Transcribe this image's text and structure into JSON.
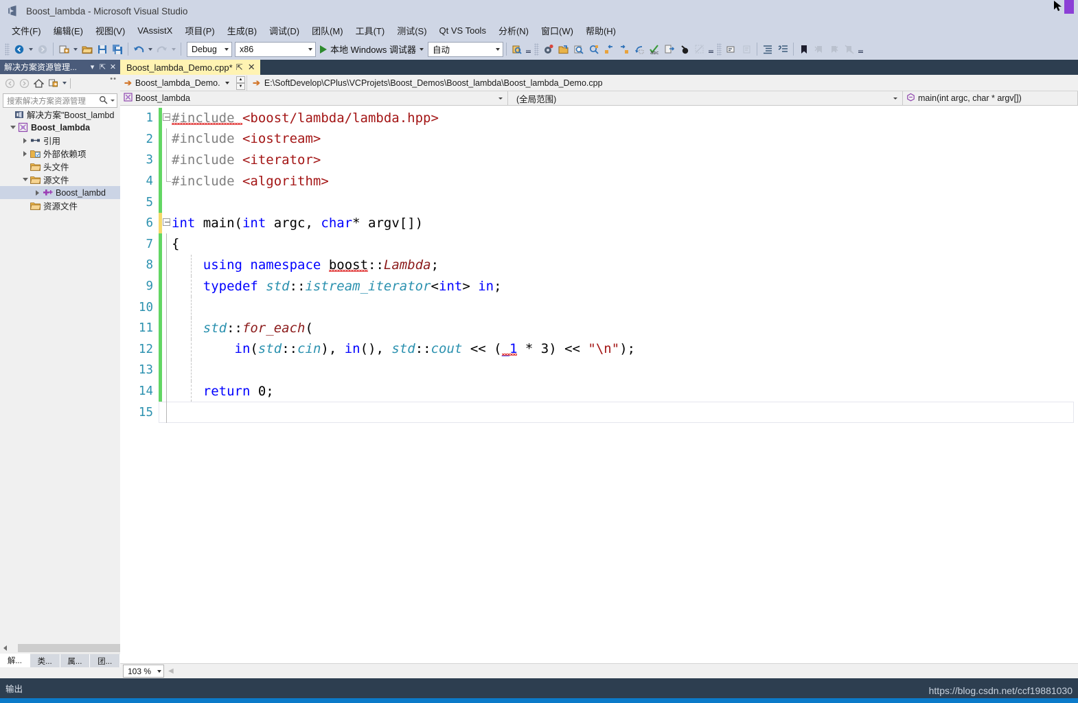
{
  "window": {
    "title": "Boost_lambda - Microsoft Visual Studio",
    "logo_icon": "visual-studio-logo-icon",
    "cursor_icon": "mouse-cursor-icon"
  },
  "menubar": {
    "items": [
      {
        "label": "文件(F)"
      },
      {
        "label": "编辑(E)"
      },
      {
        "label": "视图(V)"
      },
      {
        "label": "VAssistX"
      },
      {
        "label": "项目(P)"
      },
      {
        "label": "生成(B)"
      },
      {
        "label": "调试(D)"
      },
      {
        "label": "团队(M)"
      },
      {
        "label": "工具(T)"
      },
      {
        "label": "测试(S)"
      },
      {
        "label": "Qt VS Tools"
      },
      {
        "label": "分析(N)"
      },
      {
        "label": "窗口(W)"
      },
      {
        "label": "帮助(H)"
      }
    ]
  },
  "toolbar": {
    "nav_back_icon": "navigate-back-icon",
    "nav_forward_icon": "navigate-forward-icon",
    "new_project_icon": "new-project-icon",
    "open_file_icon": "open-file-icon",
    "save_icon": "save-icon",
    "save_all_icon": "save-all-icon",
    "undo_icon": "undo-icon",
    "redo_icon": "redo-icon",
    "config_value": "Debug",
    "platform_value": "x86",
    "start_debug_icon": "start-debug-play-icon",
    "debug_target_label": "本地 Windows 调试器",
    "auto_value": "自动",
    "icons_right": [
      "find-symbol-icon",
      "vassist-settings-icon",
      "open-corresponding-file-icon",
      "find-references-icon",
      "find-symbol-dialog-icon",
      "goto-previous-icon",
      "goto-next-icon",
      "refactor-icon",
      "spell-check-icon",
      "open-file-in-solution-icon",
      "surround-with-icon",
      "vassist-disabled-icon",
      "comment-selection-icon",
      "uncomment-selection-icon",
      "increase-indent-icon",
      "comment-block-icon",
      "bookmark-icon",
      "previous-bookmark-icon",
      "next-bookmark-icon",
      "clear-bookmarks-icon"
    ]
  },
  "solution_explorer": {
    "title": "解决方案资源管理...",
    "dropdown_icon": "chevron-down-icon",
    "pin_icon": "pin-icon",
    "close_icon": "close-icon",
    "toolbar_icons": [
      "back-arrow-icon",
      "forward-arrow-icon",
      "home-icon",
      "sync-with-active-document-icon",
      "more-options-icon"
    ],
    "search_placeholder": "搜索解决方案资源管理",
    "search_icon": "search-icon",
    "tree": [
      {
        "label": "解决方案\"Boost_lambd",
        "icon": "solution-icon",
        "indent": 0,
        "expander": "none",
        "bold": false,
        "selected": false
      },
      {
        "label": "Boost_lambda",
        "icon": "cpp-project-icon",
        "indent": 1,
        "expander": "open",
        "bold": true,
        "selected": false
      },
      {
        "label": "引用",
        "icon": "references-icon",
        "indent": 2,
        "expander": "closed",
        "bold": false,
        "selected": false
      },
      {
        "label": "外部依赖项",
        "icon": "external-dependencies-icon",
        "indent": 2,
        "expander": "closed",
        "bold": false,
        "selected": false
      },
      {
        "label": "头文件",
        "icon": "folder-icon",
        "indent": 2,
        "expander": "none",
        "bold": false,
        "selected": false
      },
      {
        "label": "源文件",
        "icon": "folder-icon",
        "indent": 2,
        "expander": "open",
        "bold": false,
        "selected": false
      },
      {
        "label": "Boost_lambd",
        "icon": "cpp-file-icon",
        "indent": 3,
        "expander": "closed",
        "bold": false,
        "selected": true
      },
      {
        "label": "资源文件",
        "icon": "folder-icon",
        "indent": 2,
        "expander": "none",
        "bold": false,
        "selected": false
      }
    ],
    "scroll_left_icon": "scroll-left-icon",
    "scroll_right_icon": "scroll-right-icon",
    "bottom_tabs": [
      {
        "label": "解...",
        "active": true
      },
      {
        "label": "类...",
        "active": false
      },
      {
        "label": "属...",
        "active": false
      },
      {
        "label": "团...",
        "active": false
      }
    ]
  },
  "editor": {
    "tab_label": "Boost_lambda_Demo.cpp*",
    "tab_pin_icon": "pin-icon",
    "tab_close_icon": "close-icon",
    "file_combo_value": "Boost_lambda_Demo.cp",
    "file_combo_arrow_icon": "goto-arrow-icon",
    "path_arrow_icon": "goto-arrow-icon",
    "path_value": "E:\\SoftDevelop\\CPlus\\VCProjets\\Boost_Demos\\Boost_lambda\\Boost_lambda_Demo.cpp",
    "scope_project_icon": "cpp-project-icon",
    "scope_project_value": "Boost_lambda",
    "scope_member_value": "(全局范围)",
    "scope_function_icon": "method-icon",
    "scope_function_value": "main(int argc, char * argv[])",
    "zoom_value": "103 %",
    "zoom_arrow_icon": "chevron-down-icon",
    "current_line": 15,
    "lines": [
      {
        "number": 1,
        "change": "green",
        "fold": "start",
        "tokens": [
          {
            "t": "#include ",
            "c": "pp",
            "squiggle": true
          },
          {
            "t": "<boost/lambda/lambda.hpp>",
            "c": "hdr"
          }
        ]
      },
      {
        "number": 2,
        "change": "green",
        "fold": "mid",
        "tokens": [
          {
            "t": "#include ",
            "c": "pp"
          },
          {
            "t": "<iostream>",
            "c": "hdr"
          }
        ]
      },
      {
        "number": 3,
        "change": "green",
        "fold": "mid",
        "tokens": [
          {
            "t": "#include ",
            "c": "pp"
          },
          {
            "t": "<iterator>",
            "c": "hdr"
          }
        ]
      },
      {
        "number": 4,
        "change": "green",
        "fold": "end",
        "tokens": [
          {
            "t": "#include ",
            "c": "pp"
          },
          {
            "t": "<algorithm>",
            "c": "hdr"
          }
        ]
      },
      {
        "number": 5,
        "change": "green",
        "fold": "none",
        "tokens": []
      },
      {
        "number": 6,
        "change": "yellow",
        "fold": "start",
        "tokens": [
          {
            "t": "int",
            "c": "k"
          },
          {
            "t": " main(",
            "c": "plain"
          },
          {
            "t": "int",
            "c": "k"
          },
          {
            "t": " argc, ",
            "c": "plain"
          },
          {
            "t": "char",
            "c": "k"
          },
          {
            "t": "* argv[])",
            "c": "plain"
          }
        ]
      },
      {
        "number": 7,
        "change": "green",
        "fold": "brace",
        "tokens": [
          {
            "t": "{",
            "c": "plain"
          }
        ]
      },
      {
        "number": 8,
        "change": "green",
        "fold": "body",
        "tokens": [
          {
            "t": "    ",
            "c": "plain"
          },
          {
            "t": "using",
            "c": "k"
          },
          {
            "t": " ",
            "c": "plain"
          },
          {
            "t": "namespace",
            "c": "k"
          },
          {
            "t": " ",
            "c": "plain"
          },
          {
            "t": "boost",
            "c": "plain",
            "squiggle": true
          },
          {
            "t": "::",
            "c": "plain"
          },
          {
            "t": "Lambda",
            "c": "usr"
          },
          {
            "t": ";",
            "c": "plain"
          }
        ]
      },
      {
        "number": 9,
        "change": "green",
        "fold": "body",
        "tokens": [
          {
            "t": "    ",
            "c": "plain"
          },
          {
            "t": "typedef",
            "c": "k"
          },
          {
            "t": " ",
            "c": "plain"
          },
          {
            "t": "std",
            "c": "tp"
          },
          {
            "t": "::",
            "c": "plain"
          },
          {
            "t": "istream_iterator",
            "c": "tp"
          },
          {
            "t": "<",
            "c": "plain"
          },
          {
            "t": "int",
            "c": "k"
          },
          {
            "t": "> ",
            "c": "plain"
          },
          {
            "t": "in",
            "c": "k"
          },
          {
            "t": ";",
            "c": "plain"
          }
        ]
      },
      {
        "number": 10,
        "change": "green",
        "fold": "body",
        "tokens": []
      },
      {
        "number": 11,
        "change": "green",
        "fold": "body",
        "tokens": [
          {
            "t": "    ",
            "c": "plain"
          },
          {
            "t": "std",
            "c": "tp"
          },
          {
            "t": "::",
            "c": "plain"
          },
          {
            "t": "for_each",
            "c": "usr"
          },
          {
            "t": "(",
            "c": "plain"
          }
        ]
      },
      {
        "number": 12,
        "change": "green",
        "fold": "body",
        "tokens": [
          {
            "t": "        ",
            "c": "plain"
          },
          {
            "t": "in",
            "c": "k"
          },
          {
            "t": "(",
            "c": "plain"
          },
          {
            "t": "std",
            "c": "tp"
          },
          {
            "t": "::",
            "c": "plain"
          },
          {
            "t": "cin",
            "c": "tp"
          },
          {
            "t": "), ",
            "c": "plain"
          },
          {
            "t": "in",
            "c": "k"
          },
          {
            "t": "(), ",
            "c": "plain"
          },
          {
            "t": "std",
            "c": "tp"
          },
          {
            "t": "::",
            "c": "plain"
          },
          {
            "t": "cout",
            "c": "tp"
          },
          {
            "t": " << (",
            "c": "plain"
          },
          {
            "t": "_1",
            "c": "k",
            "squiggle": true
          },
          {
            "t": " * 3) << ",
            "c": "plain"
          },
          {
            "t": "\"\\n\"",
            "c": "st"
          },
          {
            "t": ");",
            "c": "plain"
          }
        ]
      },
      {
        "number": 13,
        "change": "green",
        "fold": "body",
        "tokens": []
      },
      {
        "number": 14,
        "change": "green",
        "fold": "body",
        "tokens": [
          {
            "t": "    ",
            "c": "plain"
          },
          {
            "t": "return",
            "c": "k"
          },
          {
            "t": " 0;",
            "c": "plain"
          }
        ]
      },
      {
        "number": 15,
        "change": "green",
        "fold": "brace",
        "tokens": [
          {
            "t": "}",
            "c": "plain"
          }
        ]
      }
    ]
  },
  "output_pane": {
    "title": "输出"
  },
  "watermark": {
    "text": "https://blog.csdn.net/ccf19881030"
  },
  "colors": {
    "titlebar_bg": "#cfd6e5",
    "chrome_bg": "#2d3e50",
    "tab_active_bg": "#fff3b2",
    "se_header_bg": "#4a5b7a",
    "statusbar_bg": "#0b7ac9",
    "line_number": "#2b91af",
    "keyword": "#0000ff",
    "preprocessor": "#808080",
    "header_string": "#a31515",
    "type_italic": "#2b91af",
    "user_func": "#8b1a1a",
    "change_bar_saved": "#63d664",
    "change_bar_unsaved": "#f5d96a"
  }
}
